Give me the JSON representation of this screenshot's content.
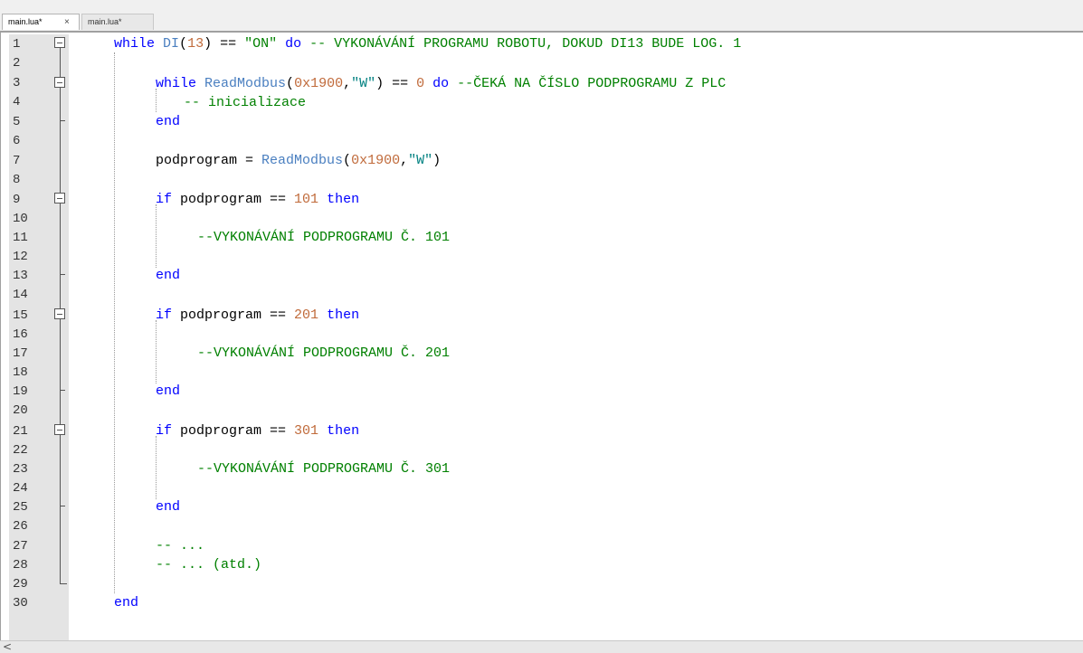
{
  "tabs": [
    {
      "label": "main.lua*",
      "close": "×"
    },
    {
      "label": "main.lua*"
    }
  ],
  "line_numbers": [
    "1",
    "2",
    "3",
    "4",
    "5",
    "6",
    "7",
    "8",
    "9",
    "10",
    "11",
    "12",
    "13",
    "14",
    "15",
    "16",
    "17",
    "18",
    "19",
    "20",
    "21",
    "22",
    "23",
    "24",
    "25",
    "26",
    "27",
    "28",
    "29",
    "30"
  ],
  "code": {
    "l1": {
      "k1": "while",
      "f1": "DI",
      "p1": "(",
      "n1": "13",
      "p2": ")",
      "o1": " == ",
      "s1": "\"ON\"",
      "k2": " do",
      "c1": " -- VYKONÁVÁNÍ PROGRAMU ROBOTU, DOKUD DI13 BUDE LOG. 1"
    },
    "l3": {
      "k1": "while",
      "f1": " ReadModbus",
      "p1": "(",
      "n1": "0x1900",
      "p2": ",",
      "s1": "\"W\"",
      "p3": ")",
      "o1": " == ",
      "n2": "0",
      "k2": " do",
      "c1": " --ČEKÁ NA ČÍSLO PODPROGRAMU Z PLC"
    },
    "l4": {
      "c1": "-- inicializace"
    },
    "l5": {
      "k1": "end"
    },
    "l7": {
      "o1": "podprogram = ",
      "f1": "ReadModbus",
      "p1": "(",
      "n1": "0x1900",
      "p2": ",",
      "s1": "\"W\"",
      "p3": ")"
    },
    "l9": {
      "k1": "if",
      "o1": " podprogram == ",
      "n1": "101",
      "k2": " then"
    },
    "l11": {
      "c1": "--VYKONÁVÁNÍ PODPROGRAMU Č. 101"
    },
    "l13": {
      "k1": "end"
    },
    "l15": {
      "k1": "if",
      "o1": " podprogram == ",
      "n1": "201",
      "k2": " then"
    },
    "l17": {
      "c1": "--VYKONÁVÁNÍ PODPROGRAMU Č. 201"
    },
    "l19": {
      "k1": "end"
    },
    "l21": {
      "k1": "if",
      "o1": " podprogram == ",
      "n1": "301",
      "k2": " then"
    },
    "l23": {
      "c1": "--VYKONÁVÁNÍ PODPROGRAMU Č. 301"
    },
    "l25": {
      "k1": "end"
    },
    "l27": {
      "c1": "-- ..."
    },
    "l28": {
      "c1": "-- ... (atd.)"
    },
    "l30": {
      "k1": "end"
    }
  },
  "scrollbar": {
    "left_arrow": "<"
  },
  "colors": {
    "keyword": "#0000ff",
    "function": "#4a7fc0",
    "number": "#c06a3a",
    "string": "#008080",
    "comment": "#008000",
    "gutter": "#e4e4e4"
  }
}
